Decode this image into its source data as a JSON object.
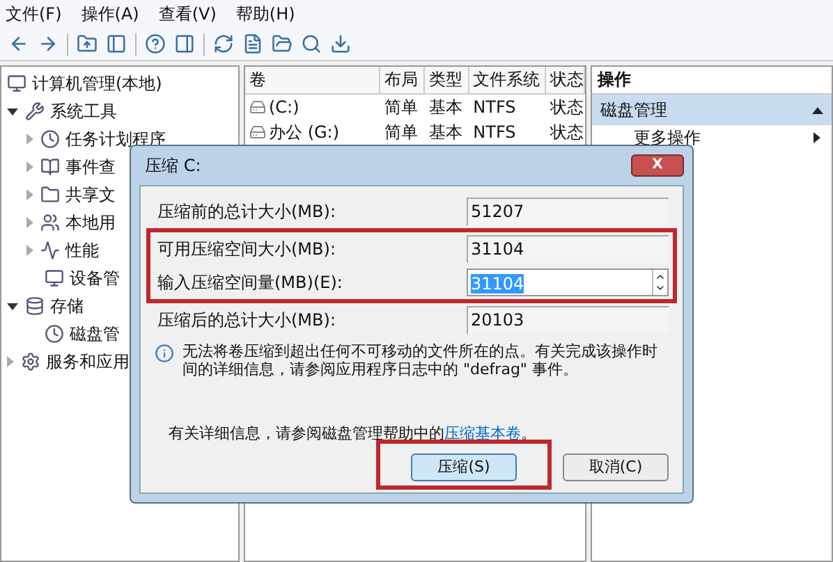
{
  "menu": [
    "文件(F)",
    "操作(A)",
    "查看(V)",
    "帮助(H)"
  ],
  "tree": {
    "label": "计算机管理(本地)",
    "children": [
      {
        "label": "系统工具",
        "expanded": true,
        "children": [
          {
            "label": "任务计划程序",
            "expanded": false
          },
          {
            "label": "事件查",
            "expanded": false
          },
          {
            "label": "共享文",
            "expanded": false
          },
          {
            "label": "本地用",
            "expanded": false
          },
          {
            "label": "性能",
            "expanded": false
          },
          {
            "label": "设备管"
          }
        ]
      },
      {
        "label": "存储",
        "expanded": true,
        "children": [
          {
            "label": "磁盘管"
          }
        ]
      },
      {
        "label": "服务和应用",
        "expanded": false
      }
    ]
  },
  "volumes": {
    "columns": [
      "卷",
      "布局",
      "类型",
      "文件系统",
      "状态"
    ],
    "rows": [
      {
        "cells": [
          "(C:)",
          "简单",
          "基本",
          "NTFS",
          "状态"
        ]
      },
      {
        "cells": [
          "办公 (G:)",
          "简单",
          "基本",
          "NTFS",
          "状态"
        ]
      }
    ]
  },
  "actions": {
    "title": "操作",
    "section": "磁盘管理",
    "items": [
      "更多操作"
    ]
  },
  "dialog": {
    "title": "压缩 C:",
    "close": "X",
    "fields": [
      {
        "kind": "readonly",
        "label": "压缩前的总计大小(MB):",
        "value": "51207",
        "highlighted": false
      },
      {
        "kind": "readonly",
        "label": "可用压缩空间大小(MB):",
        "value": "31104",
        "highlighted": true
      },
      {
        "kind": "spin",
        "label": "输入压缩空间量(MB)(E):",
        "value": "31104",
        "highlighted": true
      },
      {
        "kind": "readonly",
        "label": "压缩后的总计大小(MB):",
        "value": "20103",
        "highlighted": false
      }
    ],
    "info": "无法将卷压缩到超出任何不可移动的文件所在的点。有关完成该操作时间的详细信息，请参阅应用程序日志中的 \"defrag\" 事件。",
    "help_text": "有关详细信息，请参阅磁盘管理帮助中的",
    "help_link": "压缩基本卷",
    "help_end": "。",
    "buttons": [
      {
        "label": "压缩(S)",
        "default": true,
        "highlighted": true
      },
      {
        "label": "取消(C)",
        "default": false,
        "highlighted": false
      }
    ]
  }
}
